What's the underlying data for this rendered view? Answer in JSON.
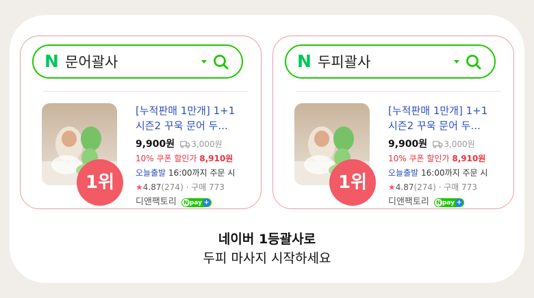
{
  "logo": "N",
  "cards": [
    {
      "query": "문어괄사",
      "rank": "1위",
      "title_line1": "[누적판매 1만개] 1+1",
      "title_line2": "시즌2 꾸욱 문어 두...",
      "price": "9,900원",
      "shipping": "3,000원",
      "coupon_prefix": "10% 쿠폰 할인가",
      "coupon_price": "8,910원",
      "delivery_label": "오늘출발",
      "delivery_text": "16:00까지 주문 시",
      "rating_score": "4.87",
      "rating_count": "(274)",
      "purchase": "· 구매 773",
      "seller": "디앤팩토리",
      "npay": "pay"
    },
    {
      "query": "두피괄사",
      "rank": "1위",
      "title_line1": "[누적판매 1만개] 1+1",
      "title_line2": "시즌2 꾸욱 문어 두...",
      "price": "9,900원",
      "shipping": "3,000원",
      "coupon_prefix": "10% 쿠폰 할인가",
      "coupon_price": "8,910원",
      "delivery_label": "오늘출발",
      "delivery_text": "16:00까지 주문 시",
      "rating_score": "4.87",
      "rating_count": "(274)",
      "purchase": "· 구매 773",
      "seller": "디앤팩토리",
      "npay": "pay"
    }
  ],
  "caption": {
    "headline": "네이버 1등괄사로",
    "subline": "두피 마사지 시작하세요"
  },
  "colors": {
    "naver_green": "#03c75a",
    "border_pink": "#f1999f",
    "rank_red": "#f25a65",
    "title_blue": "#2e4fbd",
    "coupon_red": "#e8333e"
  },
  "icons": {
    "search": "search-icon",
    "caret": "chevron-down-icon",
    "truck": "truck-icon",
    "star": "star-icon"
  }
}
